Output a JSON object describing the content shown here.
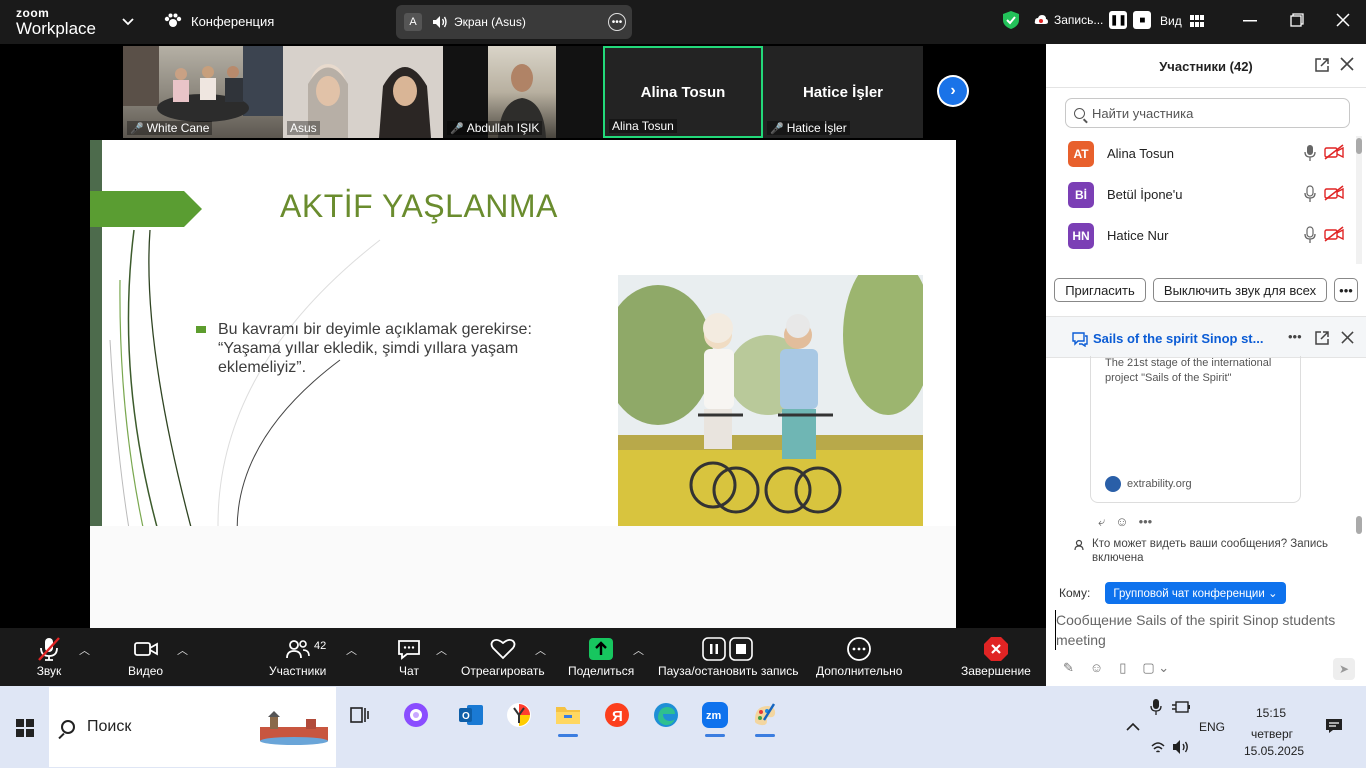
{
  "topbar": {
    "logo_line1": "zoom",
    "logo_line2": "Workplace",
    "meeting_label": "Конференция",
    "screen_avatar": "A",
    "screen_label": "Экран (Asus)",
    "record_label": "Запись...",
    "view_label": "Вид"
  },
  "thumbnails": [
    {
      "name": "White Cane",
      "muted": true
    },
    {
      "name": "Asus",
      "muted": false
    },
    {
      "name": "Abdullah IŞIK",
      "muted": true
    },
    {
      "name": "Alina Tosun",
      "big": "Alina Tosun",
      "muted": false,
      "active": true
    },
    {
      "name": "Hatice İşler",
      "big": "Hatice İşler",
      "muted": true
    }
  ],
  "slide": {
    "title": "AKTİF YAŞLANMA",
    "bullet": "Bu kavramı bir deyimle açıklamak gerekirse: “Yaşama yıllar ekledik, şimdi yıllara yaşam eklemeliyiz”."
  },
  "toolbar": {
    "audio": "Звук",
    "video": "Видео",
    "participants": "Участники",
    "participants_count": "42",
    "chat": "Чат",
    "react": "Отреагировать",
    "share": "Поделиться",
    "pause_record": "Пауза/остановить запись",
    "more": "Дополнительно",
    "end": "Завершение"
  },
  "panel": {
    "title": "Участники (42)",
    "search_placeholder": "Найти участника",
    "participants": [
      {
        "initials": "AT",
        "name": "Alina Tosun",
        "color": "#e8602c"
      },
      {
        "initials": "Bİ",
        "name": "Betül İpone'u",
        "color": "#7b3fb5"
      },
      {
        "initials": "HN",
        "name": "Hatice Nur",
        "color": "#7b3fb5"
      }
    ],
    "invite": "Пригласить",
    "mute_all": "Выключить звук для всех",
    "chat_title": "Sails of the spirit Sinop st...",
    "card_text": "The 21st stage of the international project \"Sails of the Spirit\"",
    "card_domain": "extrability.org",
    "visibility_note": "Кто может видеть ваши сообщения? Запись включена",
    "to_label": "Кому:",
    "to_value": "Групповой чат конференции",
    "message_placeholder": "Сообщение Sails of the spirit Sinop students meeting"
  },
  "taskbar": {
    "search": "Поиск",
    "lang": "ENG",
    "time": "15:15",
    "day": "четверг",
    "date": "15.05.2025"
  },
  "colors": {
    "zoom_blue": "#0e72ed",
    "active_green": "#23d97a",
    "share_green": "#17c65f",
    "end_red": "#e02424",
    "slide_title_green": "#6a8c2e"
  }
}
